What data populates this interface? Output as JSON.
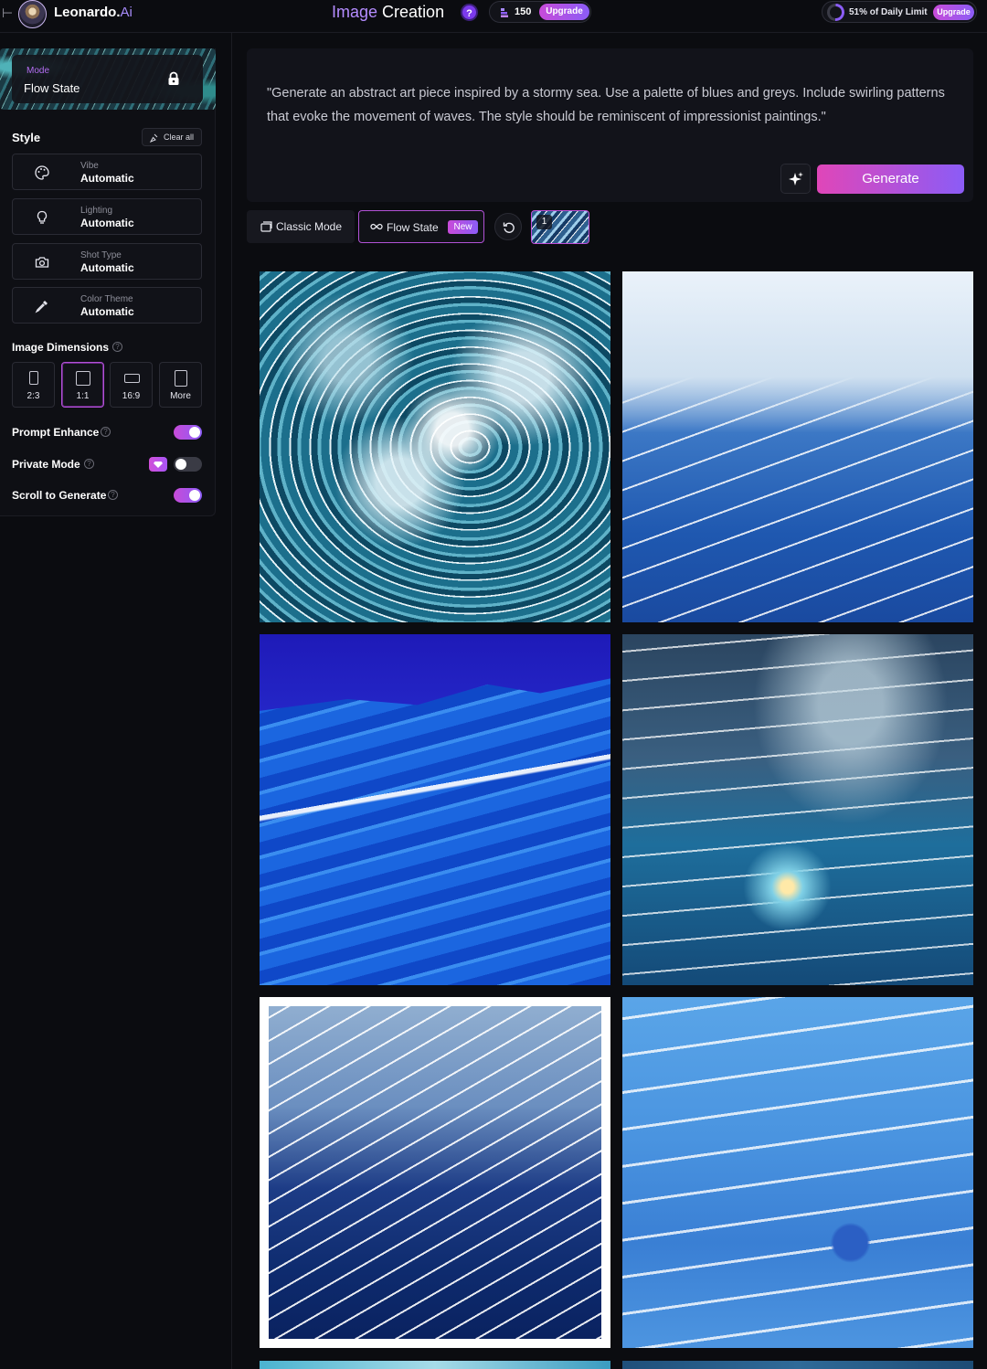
{
  "header": {
    "collapse_glyph": "⊢",
    "logo_text": "Leonardo.",
    "logo_suffix": "Ai",
    "title_part1": "Image",
    "title_part2": "Creation",
    "help_glyph": "?",
    "tokens": "150",
    "tokens_upgrade": "Upgrade",
    "limit_text": "51% of Daily Limit",
    "limit_fraction": 0.51,
    "limit_upgrade": "Upgrade"
  },
  "sidebar": {
    "mode_label": "Mode",
    "mode_value": "Flow State",
    "style_label": "Style",
    "clear_all": "Clear all",
    "style_items": [
      {
        "key": "Vibe",
        "value": "Automatic",
        "icon": "palette-icon"
      },
      {
        "key": "Lighting",
        "value": "Automatic",
        "icon": "lightbulb-icon"
      },
      {
        "key": "Shot Type",
        "value": "Automatic",
        "icon": "camera-icon"
      },
      {
        "key": "Color Theme",
        "value": "Automatic",
        "icon": "eyedropper-icon"
      }
    ],
    "dimensions_label": "Image Dimensions",
    "dimensions": [
      {
        "label": "2:3",
        "selected": false
      },
      {
        "label": "1:1",
        "selected": true
      },
      {
        "label": "16:9",
        "selected": false
      },
      {
        "label": "More",
        "selected": false
      }
    ],
    "toggles": [
      {
        "label": "Prompt Enhance",
        "on": true
      },
      {
        "label": "Private Mode",
        "on": false
      },
      {
        "label": "Scroll to Generate",
        "on": true
      }
    ]
  },
  "prompt": {
    "text": "\"Generate an abstract art piece inspired by a stormy sea. Use a palette of blues and greys. Include swirling patterns that evoke the movement of waves. The style should be reminiscent of impressionist paintings.\"",
    "generate_label": "Generate"
  },
  "modes": {
    "classic": "Classic Mode",
    "flow": "Flow State",
    "new_badge": "New",
    "thumb_count": "1"
  },
  "colors": {
    "accent_pink": "#e046b8",
    "accent_purple": "#8b5cf6",
    "background": "#0b0c10"
  }
}
